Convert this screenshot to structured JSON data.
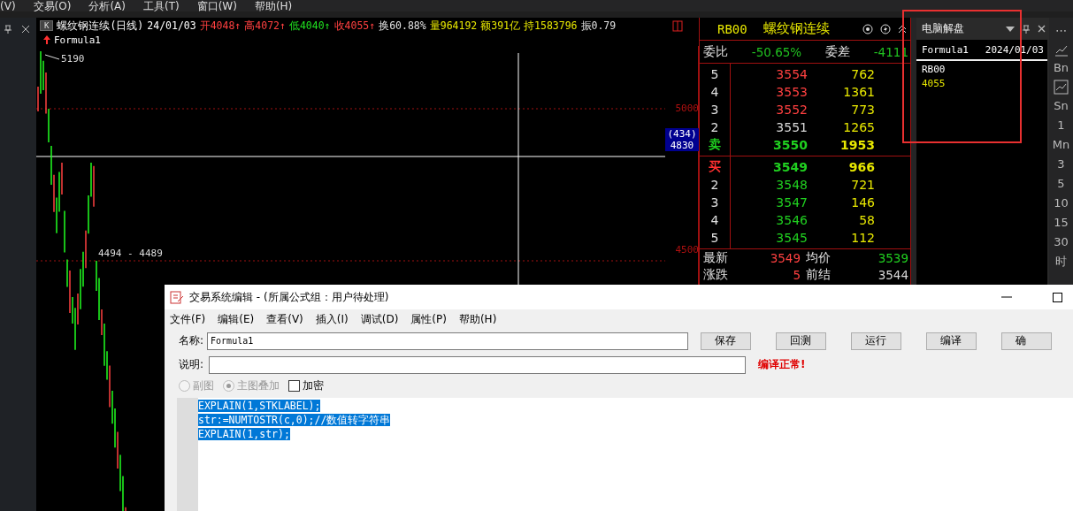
{
  "menu_bar": [
    "(V)",
    "交易(O)",
    "分析(A)",
    "工具(T)",
    "窗口(W)",
    "帮助(H)"
  ],
  "quote_bar": {
    "badge": "K",
    "title": "螺纹钢连续(日线)",
    "date": "24/01/03",
    "fields": [
      {
        "text": "开4048↑",
        "color": "#ff4040"
      },
      {
        "text": "高4072↑",
        "color": "#ff4040"
      },
      {
        "text": "低4040↑",
        "color": "#20e020"
      },
      {
        "text": "收4055↑",
        "color": "#ff4040"
      },
      {
        "text": "换60.88%",
        "color": "#e0e0e0"
      },
      {
        "text": "量964192",
        "color": "#e8e800"
      },
      {
        "text": "额391亿",
        "color": "#e8e800"
      },
      {
        "text": "持1583796",
        "color": "#e8e800"
      },
      {
        "text": "振0.79",
        "color": "#e0e0e0"
      }
    ]
  },
  "formula_label": "Formula1",
  "chart_labels": {
    "high": "5190",
    "low_range": "4494 - 4489",
    "axis": [
      "5000",
      "4500"
    ],
    "cursor_change": "(434)",
    "cursor_price": "4830"
  },
  "order_book": {
    "code": "RB00",
    "name": "螺纹钢连续",
    "ratio_label": "委比",
    "ratio": "-50.65%",
    "diff_label": "委差",
    "diff": "-4111",
    "asks": [
      {
        "level": "5",
        "price": "3554",
        "volume": "762",
        "color": "#ff4040"
      },
      {
        "level": "4",
        "price": "3553",
        "volume": "1361",
        "color": "#ff4040"
      },
      {
        "level": "3",
        "price": "3552",
        "volume": "773",
        "color": "#ff4040"
      },
      {
        "level": "2",
        "price": "3551",
        "volume": "1265",
        "color": "#d8d8d8"
      },
      {
        "level": "卖",
        "price": "3550",
        "volume": "1953",
        "color": "#20d020"
      }
    ],
    "bids": [
      {
        "level": "买",
        "price": "3549",
        "volume": "966",
        "color": "#20d020"
      },
      {
        "level": "2",
        "price": "3548",
        "volume": "721",
        "color": "#20d020"
      },
      {
        "level": "3",
        "price": "3547",
        "volume": "146",
        "color": "#20d020"
      },
      {
        "level": "4",
        "price": "3546",
        "volume": "58",
        "color": "#20d020"
      },
      {
        "level": "5",
        "price": "3545",
        "volume": "112",
        "color": "#20d020"
      }
    ],
    "stats": [
      {
        "label": "最新",
        "value": "3549",
        "color": "#ff4040"
      },
      {
        "label": "均价",
        "value": "3539",
        "color": "#20d020"
      },
      {
        "label": "涨跌",
        "value": "5",
        "color": "#ff4040"
      },
      {
        "label": "前结",
        "value": "3544",
        "color": "#d8d8d8"
      }
    ]
  },
  "explain_panel": {
    "title": "电脑解盘",
    "formula": "Formula1",
    "date": "2024/01/03",
    "lines": [
      {
        "text": "RB00",
        "color": "#ffffff"
      },
      {
        "text": "4055",
        "color": "#e8e800"
      }
    ]
  },
  "period_toolbar": [
    {
      "kind": "glyph",
      "text": "⋯"
    },
    {
      "kind": "icon"
    },
    {
      "kind": "glyph",
      "text": "Bn"
    },
    {
      "kind": "boxed-icon"
    },
    {
      "kind": "glyph",
      "text": "Sn"
    },
    {
      "kind": "glyph",
      "text": "1"
    },
    {
      "kind": "glyph",
      "text": "Mn"
    },
    {
      "kind": "glyph",
      "text": "3"
    },
    {
      "kind": "glyph",
      "text": "5"
    },
    {
      "kind": "glyph",
      "text": "10"
    },
    {
      "kind": "glyph",
      "text": "15"
    },
    {
      "kind": "glyph",
      "text": "30"
    },
    {
      "kind": "glyph",
      "text": "时"
    }
  ],
  "editor": {
    "title": "交易系统编辑 - (所属公式组：用户待处理)",
    "menu": [
      "文件(F)",
      "编辑(E)",
      "查看(V)",
      "插入(I)",
      "调试(D)",
      "属性(P)",
      "帮助(H)"
    ],
    "name_label": "名称:",
    "name_value": "Formula1",
    "buttons": [
      "保存",
      "回测",
      "运行",
      "编译",
      "确"
    ],
    "desc_label": "说明:",
    "status": "编译正常!",
    "options": [
      {
        "kind": "radio",
        "label": "副图",
        "selected": false,
        "disabled": true
      },
      {
        "kind": "radio",
        "label": "主图叠加",
        "selected": true,
        "disabled": true
      },
      {
        "kind": "checkbox",
        "label": "加密",
        "checked": false,
        "disabled": false
      }
    ],
    "code": [
      {
        "text": "EXPLAIN(1,STKLABEL);",
        "selected": true
      },
      {
        "text": "str:=NUMTOSTR(c,0);//数值转字符串",
        "selected": true
      },
      {
        "text": "EXPLAIN(1,str);",
        "selected": true
      }
    ]
  }
}
